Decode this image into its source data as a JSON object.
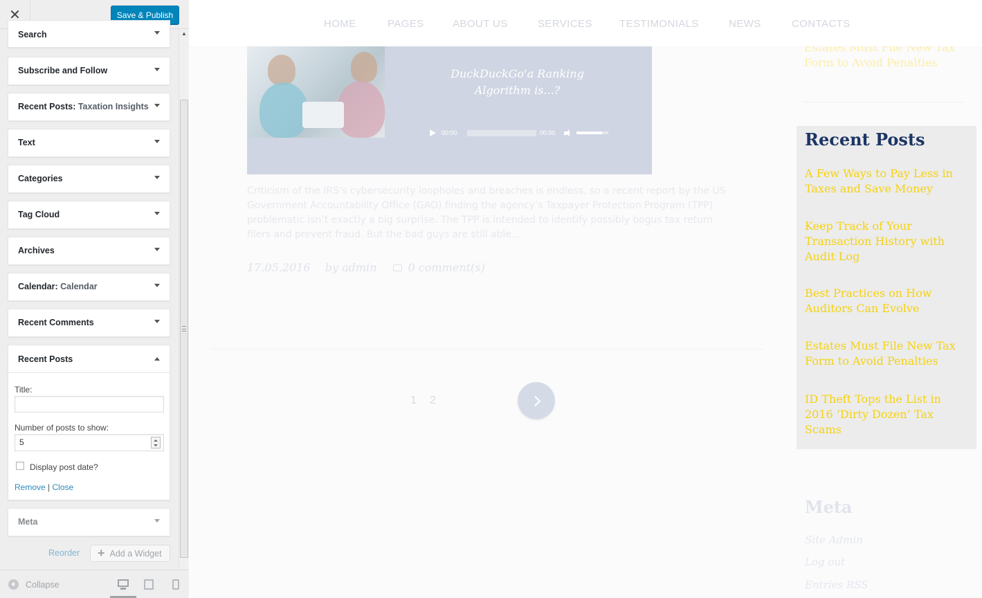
{
  "customizer": {
    "close_glyph": "✕",
    "save_label": "Save & Publish",
    "widgets": [
      {
        "title": "Search",
        "sub": ""
      },
      {
        "title": "Subscribe and Follow",
        "sub": ""
      },
      {
        "title": "Recent Posts:",
        "sub": "Taxation Insights"
      },
      {
        "title": "Text",
        "sub": ""
      },
      {
        "title": "Categories",
        "sub": ""
      },
      {
        "title": "Tag Cloud",
        "sub": ""
      },
      {
        "title": "Archives",
        "sub": ""
      },
      {
        "title": "Calendar:",
        "sub": "Calendar"
      },
      {
        "title": "Recent Comments",
        "sub": ""
      }
    ],
    "open_widget": {
      "title": "Recent Posts",
      "title_label": "Title:",
      "title_value": "",
      "num_label": "Number of posts to show:",
      "num_value": "5",
      "date_label": "Display post date?",
      "date_checked": false,
      "remove_label": "Remove",
      "separator": "|",
      "close_label": "Close"
    },
    "meta_widget": {
      "title": "Meta"
    },
    "reorder_label": "Reorder",
    "add_widget_label": "Add a Widget",
    "collapse_label": "Collapse",
    "devices": [
      "desktop-icon",
      "tablet-icon",
      "mobile-icon"
    ],
    "active_device": "desktop"
  },
  "preview": {
    "nav": [
      "HOME",
      "PAGES",
      "ABOUT US",
      "SERVICES",
      "TESTIMONIALS",
      "NEWS",
      "CONTACTS"
    ],
    "prev_post_tail": "Estates Must File New Tax Form to Avoid Penalties",
    "media": {
      "track_title": "DuckDuckGo'a Ranking Algorithm is...?",
      "current_time": "00:00",
      "duration": "00:00",
      "progress": 0,
      "volume": 0.8
    },
    "excerpt": "Criticism of the IRS’s cybersecurity loopholes and breaches is endless, so a recent report by the US Government Accountability Office (GAO) finding the agency’s Taxpayer Protection Program (TPP) problematic isn’t exactly a big surprise. The TPP is intended to identify possibly bogus tax return filers and prevent fraud. But the bad guys are still able…",
    "post_date": "17.05.2016",
    "post_author": "by admin",
    "post_comments": "0 comment(s)",
    "pages": [
      "1",
      "2"
    ],
    "recent_posts": {
      "heading": "Recent Posts",
      "items": [
        "A Few Ways to Pay Less in Taxes and Save Money",
        "Keep Track of Your Transaction History with Audit Log",
        "Best Practices on How Auditors Can Evolve",
        "Estates Must File New Tax Form to Avoid Penalties",
        "ID Theft Tops the List in 2016 ‘Dirty Dozen’ Tax Scams"
      ]
    },
    "meta": {
      "heading": "Meta",
      "links": [
        "Site Admin",
        "Log out",
        "Entries RSS"
      ]
    },
    "colors": {
      "accent_link": "#f5d20f",
      "heading": "#1d3565",
      "button": "#0085ba"
    }
  }
}
